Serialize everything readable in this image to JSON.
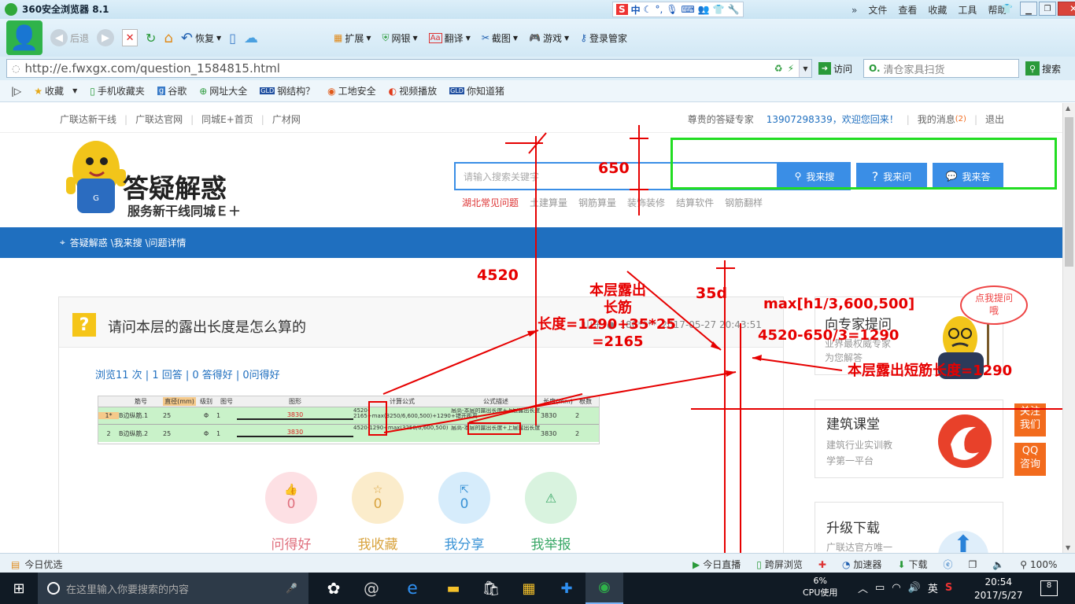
{
  "browser": {
    "title": "360安全浏览器 8.1",
    "menu": [
      "文件",
      "查看",
      "收藏",
      "工具",
      "帮助"
    ],
    "ime": "中",
    "back_label": "后退",
    "restore_label": "恢复",
    "toolbar_items": [
      "扩展",
      "网银",
      "翻译",
      "截图",
      "游戏",
      "登录管家"
    ],
    "url": "http://e.fwxgx.com/question_1584815.html",
    "visit_label": "访问",
    "search_placeholder": "清仓家具扫货",
    "search_button": "搜索",
    "favorites": [
      "收藏",
      "手机收藏夹",
      "谷歌",
      "网址大全",
      "钢结构？",
      "工地安全",
      "视频播放",
      "你知道猪"
    ]
  },
  "site": {
    "topnav": [
      "广联达新干线",
      "广联达官网",
      "同城E+首页",
      "广材网"
    ],
    "greeting_role": "尊贵的答疑专家",
    "greeting_user": "13907298339，欢迎您回来！",
    "messages": "我的消息",
    "message_count": "(2)",
    "logout": "退出",
    "logo_title": "答疑解惑",
    "logo_subtitle": "服务新干线同城Ｅ＋",
    "search_placeholder": "请输入搜索关键字",
    "btn_search": "我来搜",
    "btn_ask": "我来问",
    "btn_answer": "我来答",
    "hot_links": [
      "湖北常见问题",
      "土建算量",
      "钢筋算量",
      "装饰装修",
      "结算软件",
      "钢筋翻样"
    ],
    "breadcrumb": "答疑解惑 \\我来搜 \\问题详情"
  },
  "question": {
    "title": "请问本层的露出长度是怎么算的",
    "author": "山东",
    "author_masked": "180****",
    "time": "2017-05-27 20:43:51",
    "stats": "浏览11 次 | 1 回答 | 0 答得好 | 0问得好",
    "table_headers": [
      "筋号",
      "直径(mm)",
      "级别",
      "图号",
      "图形",
      "计算公式",
      "公式描述",
      "长度(mm)",
      "根数"
    ],
    "table_rows": [
      {
        "idx": "1*",
        "name": "B边纵筋.1",
        "dia": "25",
        "grade": "Φ",
        "fig": "1",
        "shape": "3830",
        "formula": "4520-2165+max(3250/6,600,500)+1290+35*d,500)",
        "desc": "层高-本层的露出长度+上层露出长度+错开距离",
        "len": "3830",
        "count": "2"
      },
      {
        "idx": "2",
        "name": "B边纵筋.2",
        "dia": "25",
        "grade": "Φ",
        "fig": "1",
        "shape": "3830",
        "formula": "4520-1290+max(3250/6,600,500)",
        "desc": "层高-本层的露出长度+上层露出长度",
        "len": "3830",
        "count": "2"
      }
    ],
    "actions": [
      {
        "label": "问得好",
        "count": "0",
        "icon": "thumbs-up-icon"
      },
      {
        "label": "我收藏",
        "count": "0",
        "icon": "star-icon"
      },
      {
        "label": "我分享",
        "count": "0",
        "icon": "share-icon"
      },
      {
        "label": "我举报",
        "count": "0",
        "icon": "warning-icon"
      }
    ]
  },
  "sidebar": {
    "expert_title": "向专家提问",
    "expert_desc1": "业界最权威专家",
    "expert_desc2": "为您解答",
    "bubble": "点我提问哦",
    "course_title": "建筑课堂",
    "course_desc1": "建筑行业实训教",
    "course_desc2": "学第一平台",
    "follow": "关注我们",
    "qq": "QQ咨询",
    "download_title": "升级下载",
    "download_desc": "广联达官方唯一"
  },
  "annotations": {
    "a650": "650",
    "a4520": "4520",
    "a35d": "35d",
    "max_expr": "max[h1/3,600,500]",
    "calc": "4520-650/3=1290",
    "long_bar1": "本层露出",
    "long_bar2": "长筋",
    "long_bar3": "长度=1290+35*25",
    "long_bar4": "=2165",
    "short_bar": "本层露出短筋长度=1290"
  },
  "status": {
    "left": "今日优选",
    "live": "今日直播",
    "cross": "跨屏浏览",
    "accelerator": "加速器",
    "download": "下载",
    "zoom": "100%"
  },
  "taskbar": {
    "search_placeholder": "在这里输入你要搜索的内容",
    "cpu_pct": "6%",
    "cpu_label": "CPU使用",
    "lang": "英",
    "time": "20:54",
    "date": "2017/5/27",
    "notif_count": "8"
  },
  "colors": {
    "accent_blue": "#1f6fbf",
    "annotation_red": "#e60000",
    "green_box": "#22dd22",
    "orange": "#f26b1d"
  }
}
